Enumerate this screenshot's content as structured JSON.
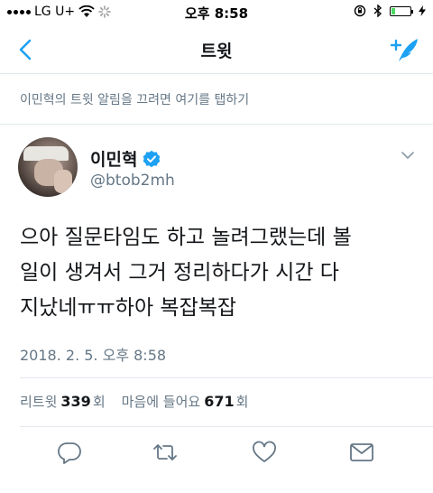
{
  "status_bar": {
    "carrier": "LG U+",
    "time": "오후 8:58",
    "colors": {
      "battery_fill": "#4cd964"
    }
  },
  "nav": {
    "title": "트윗",
    "back_icon": "chevron-left-icon",
    "compose_icon": "compose-tweet-icon"
  },
  "notice": {
    "text": "이민혁의 트윗 알림을 끄려면 여기를 탭하기"
  },
  "tweet": {
    "user_name": "이민혁",
    "handle": "@btob2mh",
    "text_lines": [
      "으아 질문타임도 하고 놀려그랬는데 볼",
      "일이 생겨서 그거 정리하다가 시간 다",
      "지났네ㅠㅠ하아 복잡복잡"
    ],
    "date": "2018. 2. 5. 오후 8:58",
    "stats": {
      "retweet_label": "리트윗",
      "retweet_count": "339",
      "retweet_unit": "회",
      "like_label": "마음에 들어요",
      "like_count": "671",
      "like_unit": "회"
    }
  },
  "actions": [
    "reply-icon",
    "retweet-icon",
    "like-icon",
    "share-icon"
  ],
  "colors": {
    "accent": "#1da1f2",
    "secondary_text": "#657786",
    "divider": "#e1e8ed"
  }
}
